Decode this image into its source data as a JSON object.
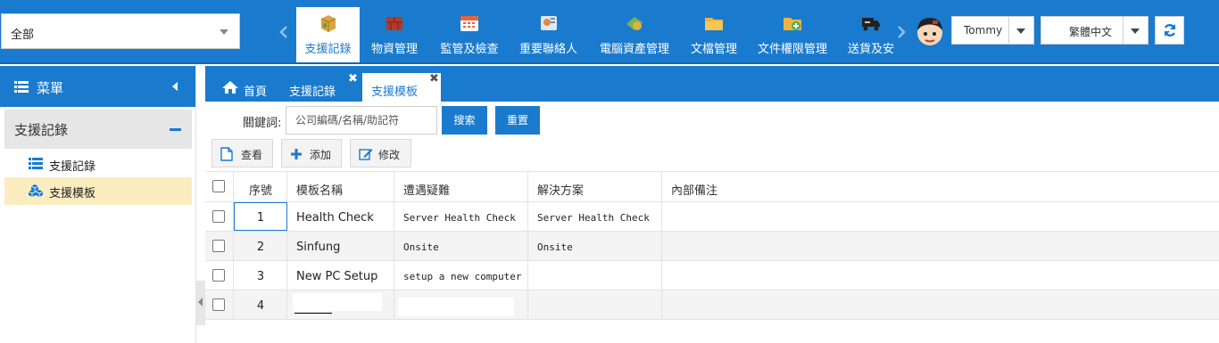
{
  "header": {
    "scope_value": "全部",
    "modules": [
      {
        "label": "支援記錄",
        "icon": "box-icon",
        "active": true
      },
      {
        "label": "物資管理",
        "icon": "bricks-icon",
        "active": false
      },
      {
        "label": "監管及檢查",
        "icon": "calendar-icon",
        "active": false
      },
      {
        "label": "重要聯絡人",
        "icon": "contact-card-icon",
        "active": false
      },
      {
        "label": "電腦資產管理",
        "icon": "money-icon",
        "active": false
      },
      {
        "label": "文檔管理",
        "icon": "folder-icon",
        "active": false
      },
      {
        "label": "文件權限管理",
        "icon": "folder-add-icon",
        "active": false
      },
      {
        "label": "送貨及安",
        "icon": "truck-icon",
        "active": false
      }
    ],
    "user_name": "Tommy",
    "language": "繁體中文",
    "colors": {
      "primary": "#1a7bce",
      "selected_row": "#fcedc0"
    }
  },
  "sidebar": {
    "title": "菜單",
    "section": "支援記錄",
    "items": [
      {
        "label": "支援記錄",
        "icon": "list-icon"
      },
      {
        "label": "支援模板",
        "icon": "cubes-icon",
        "selected": true
      }
    ]
  },
  "tabs": [
    {
      "label": "首頁",
      "icon": "home-icon"
    },
    {
      "label": "支援記錄",
      "close": "✖"
    },
    {
      "label": "支援模板",
      "close": "✖",
      "active": true
    }
  ],
  "search": {
    "label": "關鍵詞:",
    "placeholder": "公司編碼/名稱/助記符",
    "search_button": "搜索",
    "reset_button": "重置"
  },
  "toolbar": {
    "view": "查看",
    "add": "添加",
    "edit": "修改"
  },
  "table": {
    "columns": [
      "序號",
      "模板名稱",
      "遭遇疑難",
      "解決方案",
      "內部備注"
    ],
    "rows": [
      {
        "no": "1",
        "name": "Health Check",
        "problem": "Server Health Check",
        "solution": "Server Health Check",
        "note": ""
      },
      {
        "no": "2",
        "name": "Sinfung",
        "problem": "Onsite",
        "solution": "Onsite",
        "note": ""
      },
      {
        "no": "3",
        "name": "New PC Setup",
        "problem": "setup a new computer",
        "solution": "",
        "note": ""
      },
      {
        "no": "4",
        "name": "",
        "problem": "",
        "solution": "",
        "note": ""
      }
    ]
  }
}
